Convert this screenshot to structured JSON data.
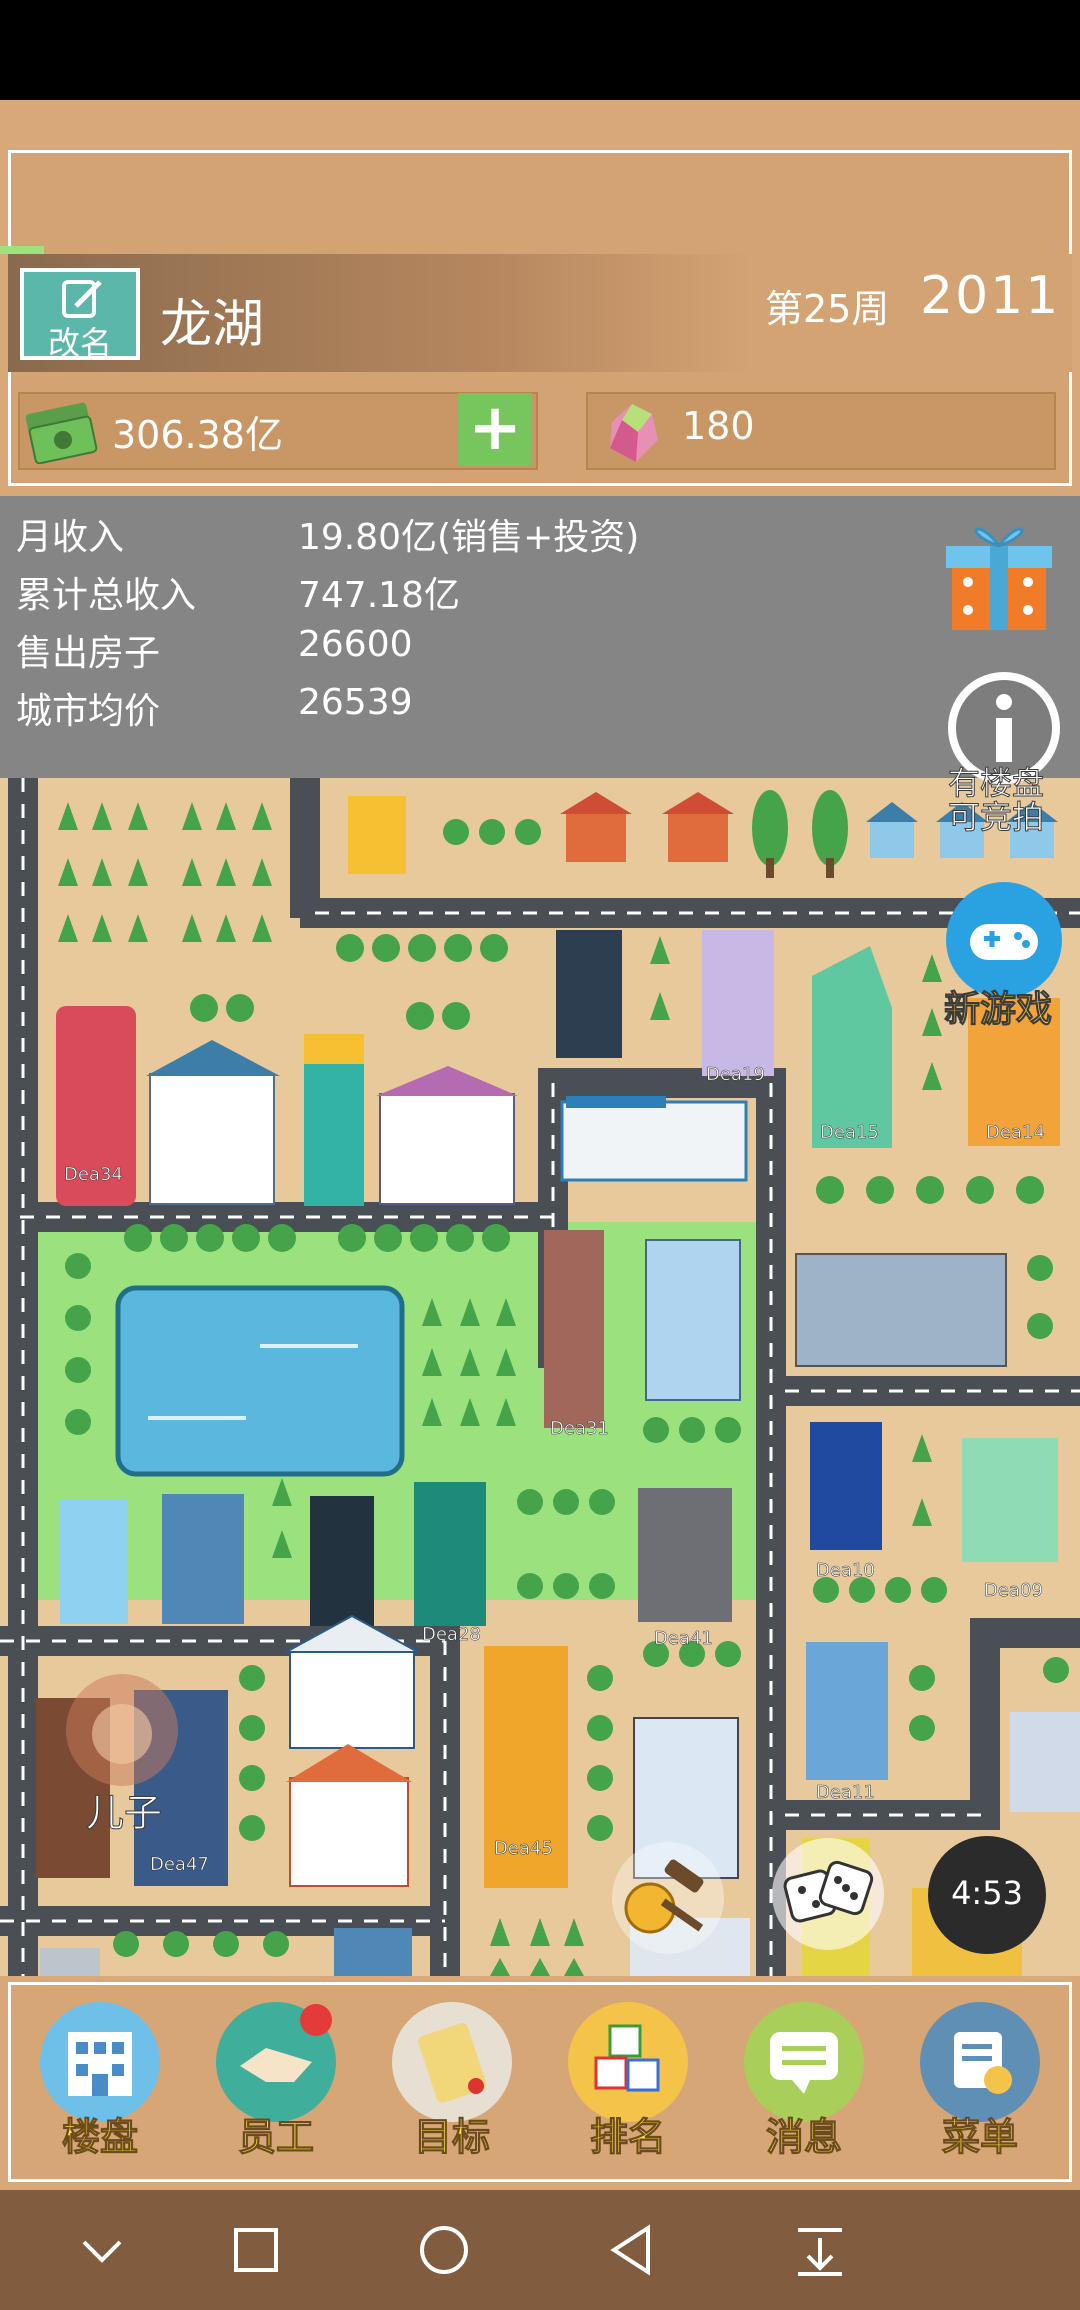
{
  "header": {
    "rename_label": "改名",
    "city_name": "龙湖",
    "week": "第25周",
    "year": "2011",
    "money": "306.38亿",
    "gems": "180"
  },
  "stats": [
    {
      "label": "月收入",
      "value": "19.80亿(销售+投资)"
    },
    {
      "label": "累计总收入",
      "value": "747.18亿"
    },
    {
      "label": "售出房子",
      "value": "26600"
    },
    {
      "label": "城市均价",
      "value": "26539"
    }
  ],
  "side_buttons": {
    "auction_line1": "有楼盘",
    "auction_line2": "可竞拍",
    "new_game": "新游戏",
    "timer": "4:53",
    "son": "儿子"
  },
  "buildings": [
    "Dea19",
    "Dea15",
    "Dea14",
    "Dea34",
    "Dea31",
    "Dea10",
    "Dea09",
    "Dea28",
    "Dea41",
    "Dea11",
    "Dea45",
    "Dea47"
  ],
  "bottom_nav": [
    {
      "label": "楼盘",
      "icon": "building-icon"
    },
    {
      "label": "员工",
      "icon": "handshake-icon"
    },
    {
      "label": "目标",
      "icon": "scroll-icon"
    },
    {
      "label": "排名",
      "icon": "abc-blocks-icon"
    },
    {
      "label": "消息",
      "icon": "message-icon"
    },
    {
      "label": "菜单",
      "icon": "menu-icon"
    }
  ],
  "colors": {
    "panel": "#d9a878",
    "stats_bg": "#858585",
    "road": "#4a4f55",
    "grass": "#9be27f",
    "nav_label": "#ffe033"
  }
}
